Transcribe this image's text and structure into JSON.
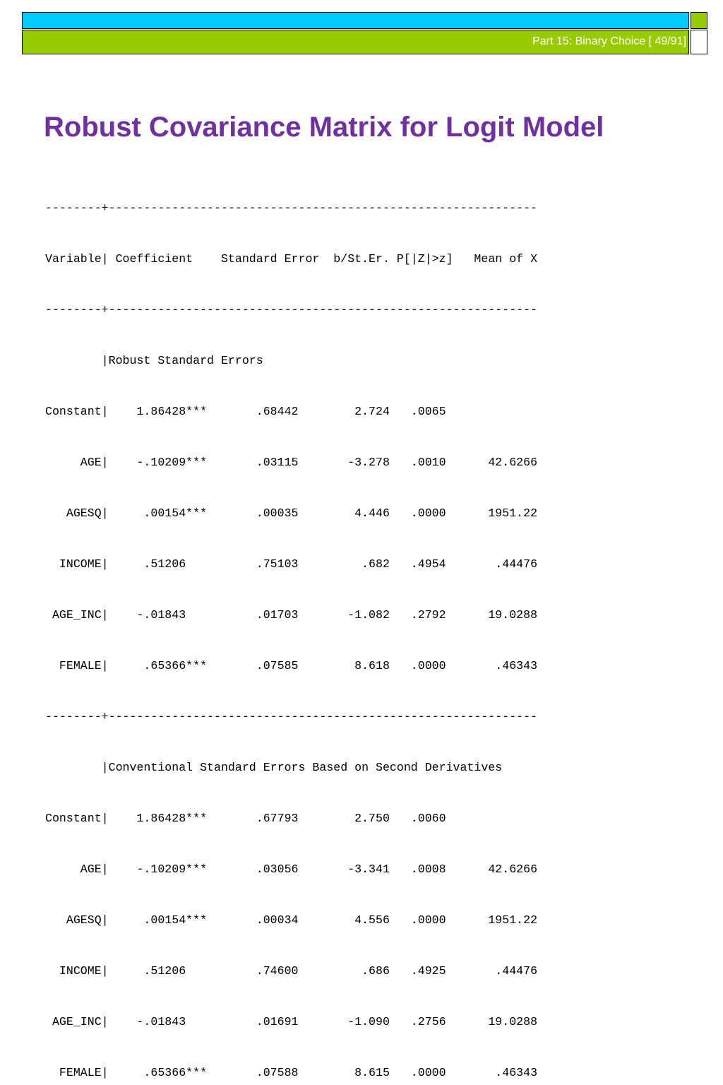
{
  "header": {
    "slide_label": "Part 15: Binary Choice [ 49/91]"
  },
  "slide": {
    "title": "Robust Covariance Matrix for Logit Model"
  },
  "output": {
    "lines": [
      "--------+-------------------------------------------------------------",
      "Variable| Coefficient    Standard Error  b/St.Er. P[|Z|>z]   Mean of X",
      "--------+-------------------------------------------------------------",
      "        |Robust Standard Errors",
      "Constant|    1.86428***       .68442        2.724   .0065",
      "     AGE|    -.10209***       .03115       -3.278   .0010      42.6266",
      "   AGESQ|     .00154***       .00035        4.446   .0000      1951.22",
      "  INCOME|     .51206          .75103         .682   .4954       .44476",
      " AGE_INC|    -.01843          .01703       -1.082   .2792      19.0288",
      "  FEMALE|     .65366***       .07585        8.618   .0000       .46343",
      "--------+-------------------------------------------------------------",
      "        |Conventional Standard Errors Based on Second Derivatives",
      "Constant|    1.86428***       .67793        2.750   .0060",
      "     AGE|    -.10209***       .03056       -3.341   .0008      42.6266",
      "   AGESQ|     .00154***       .00034        4.556   .0000      1951.22",
      "  INCOME|     .51206          .74600         .686   .4925       .44476",
      " AGE_INC|    -.01843          .01691       -1.090   .2756      19.0288",
      "  FEMALE|     .65366***       .07588        8.615   .0000       .46343"
    ]
  },
  "colors": {
    "top_bar": "#00ccff",
    "bottom_bar": "#99cc00",
    "title": "#7030a0"
  }
}
